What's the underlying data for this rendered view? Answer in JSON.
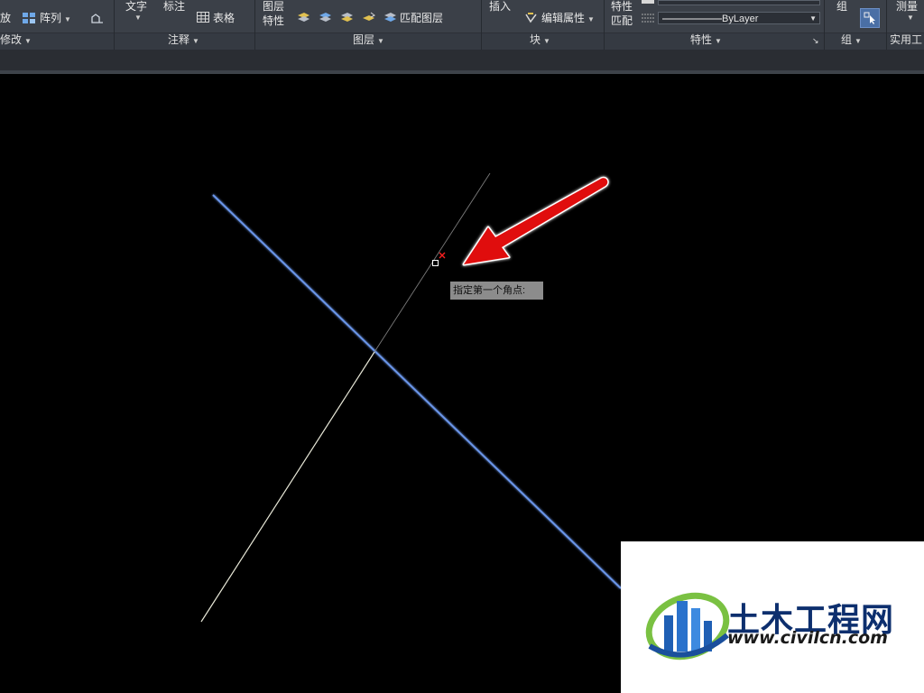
{
  "ribbon": {
    "modify": {
      "mirror_label": "放",
      "array_label": "阵列",
      "panel_title": "修改"
    },
    "annotation": {
      "text_label": "文字",
      "dimension_label": "标注",
      "table_label": "表格",
      "panel_title": "注释"
    },
    "layers": {
      "properties_label_line1": "图层",
      "properties_label_line2": "特性",
      "match_layer_label": "匹配图层",
      "panel_title": "图层"
    },
    "block": {
      "insert_label": "插入",
      "edit_attributes_label": "编辑属性",
      "panel_title": "块"
    },
    "properties": {
      "match_label_line1": "特性",
      "match_label_line2": "匹配",
      "linetype_value": "ByLayer",
      "panel_title": "特性"
    },
    "groups": {
      "group_label": "组",
      "panel_title": "组"
    },
    "utilities": {
      "measure_label": "测量",
      "panel_title": "实用工"
    }
  },
  "canvas": {
    "tooltip": "指定第一个角点:",
    "colors": {
      "background": "#000000",
      "blue_line": "#6a95e8",
      "white_line": "#e8e8d8",
      "arrow": "#e01010",
      "cursor_mark": "#ff2020"
    }
  },
  "watermark": {
    "name": "土木工程网",
    "url": "www.civilcn.com"
  }
}
